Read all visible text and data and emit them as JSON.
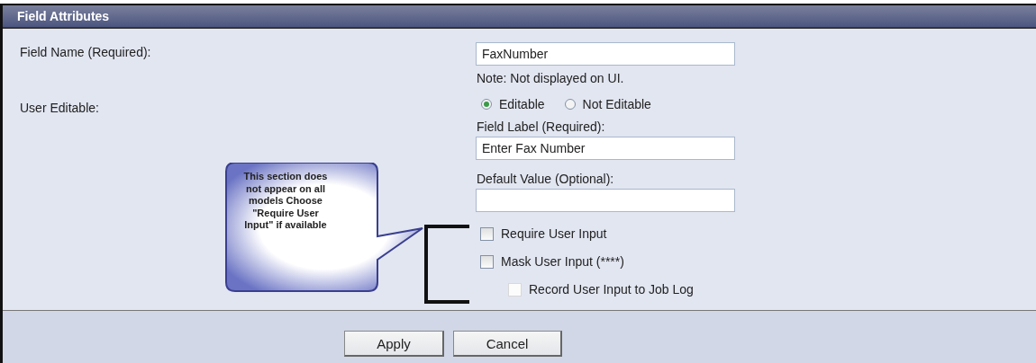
{
  "panel": {
    "title": "Field Attributes"
  },
  "rows": [
    {
      "label": "Field Name (Required):"
    },
    {
      "label": "User Editable:"
    }
  ],
  "field_name": {
    "value": "FaxNumber",
    "note": "Note: Not displayed on UI."
  },
  "editable_options": [
    {
      "label": "Editable",
      "selected": true
    },
    {
      "label": "Not Editable",
      "selected": false
    }
  ],
  "field_label": {
    "label": "Field Label (Required):",
    "value": "Enter Fax Number"
  },
  "default_value": {
    "label": "Default Value (Optional):"
  },
  "options": [
    {
      "label": "Require User Input",
      "checked": false,
      "disabled": false,
      "indented": false
    },
    {
      "label": "Mask User Input (****)",
      "checked": false,
      "disabled": false,
      "indented": false
    },
    {
      "label": "Record User Input to Job Log",
      "checked": false,
      "disabled": true,
      "indented": true
    }
  ],
  "callout": {
    "text": "This section does not appear on all models Choose \"Require User Input\" if available"
  },
  "buttons": [
    {
      "label": "Apply"
    },
    {
      "label": "Cancel"
    }
  ]
}
